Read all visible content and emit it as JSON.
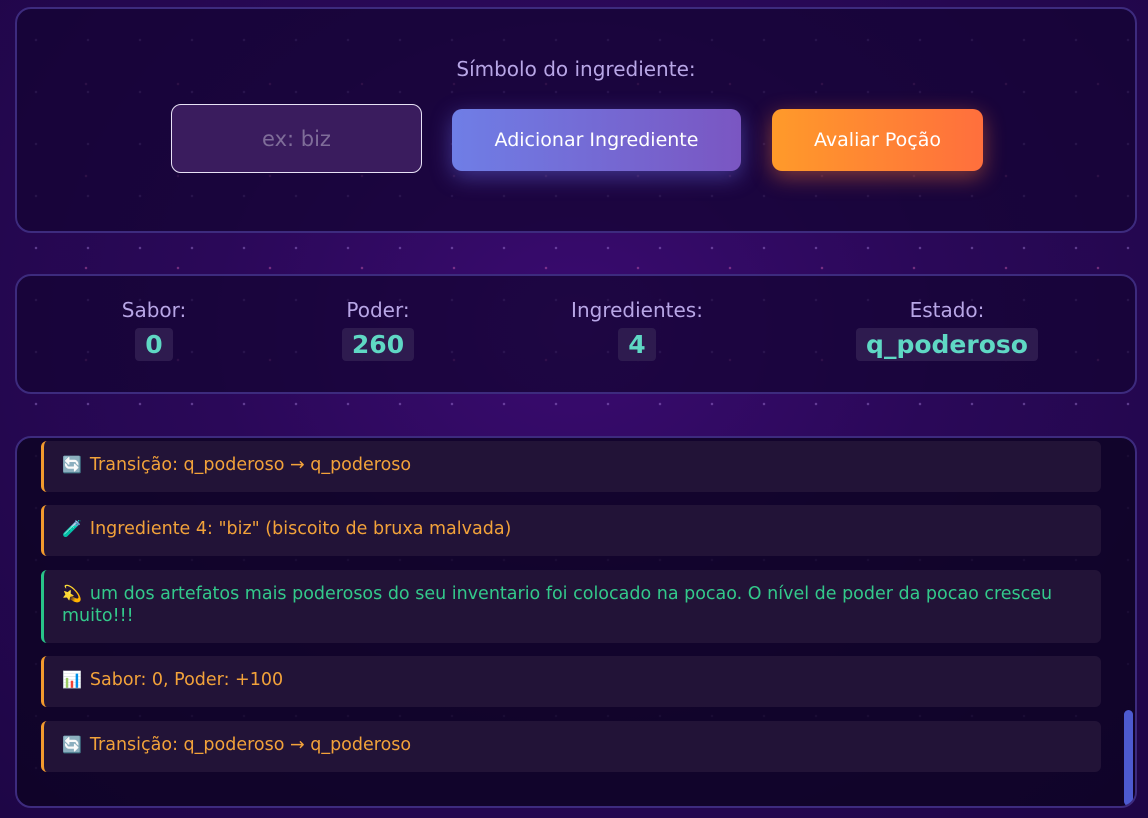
{
  "input_panel": {
    "label": "Símbolo do ingrediente:",
    "placeholder": "ex: biz",
    "value": "",
    "add_button": "Adicionar Ingrediente",
    "eval_button": "Avaliar Poção"
  },
  "stats": {
    "sabor": {
      "label": "Sabor:",
      "value": "0"
    },
    "poder": {
      "label": "Poder:",
      "value": "260"
    },
    "ingredientes": {
      "label": "Ingredientes:",
      "value": "4"
    },
    "estado": {
      "label": "Estado:",
      "value": "q_poderoso"
    }
  },
  "log": [
    {
      "icon": "🔄",
      "text": "Transição: q_poderoso → q_poderoso",
      "type": "info"
    },
    {
      "icon": "🧪",
      "text": "Ingrediente 4: \"biz\" (biscoito de bruxa malvada)",
      "type": "info"
    },
    {
      "icon": "💫",
      "text": "um dos artefatos mais poderosos do seu inventario foi colocado na pocao. O nível de poder da pocao cresceu muito!!!",
      "type": "success"
    },
    {
      "icon": "📊",
      "text": "Sabor: 0, Poder: +100",
      "type": "info"
    },
    {
      "icon": "🔄",
      "text": "Transição: q_poderoso → q_poderoso",
      "type": "info"
    }
  ],
  "colors": {
    "accent_orange": "#f2a23a",
    "accent_green": "#33c98b",
    "stat_value": "#5fd8c4"
  }
}
